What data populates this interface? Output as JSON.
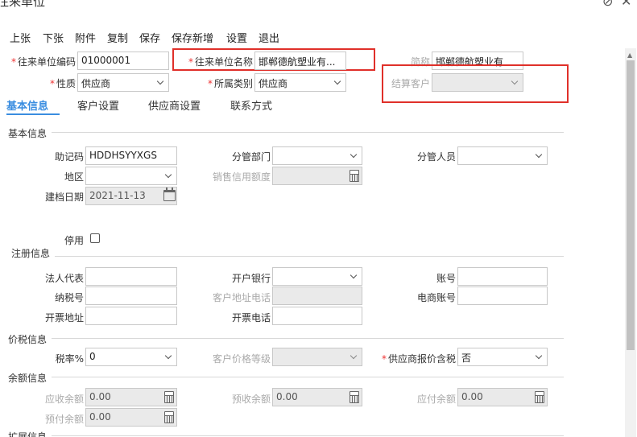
{
  "window": {
    "title": "往来单位"
  },
  "toolbar": {
    "items": [
      "上张",
      "下张",
      "附件",
      "复制",
      "保存",
      "保存新增",
      "设置",
      "退出"
    ]
  },
  "header_fields": {
    "code": {
      "label": "往来单位编码",
      "value": "01000001"
    },
    "name": {
      "label": "往来单位名称",
      "value": "邯郸德航塑业有..."
    },
    "short_name": {
      "label": "简称",
      "value": "邯郸德航塑业有"
    },
    "nature": {
      "label": "性质",
      "value": "供应商"
    },
    "category": {
      "label": "所属类别",
      "value": "供应商"
    },
    "settle_customer": {
      "label": "结算客户",
      "value": ""
    }
  },
  "tabs": [
    "基本信息",
    "客户设置",
    "供应商设置",
    "联系方式"
  ],
  "sections": {
    "basic": "基本信息",
    "register": "注册信息",
    "price_tax": "价税信息",
    "balance": "余额信息",
    "extend": "扩展信息"
  },
  "basic": {
    "mnemonic": {
      "label": "助记码",
      "value": "HDDHSYYXGS"
    },
    "dept": {
      "label": "分管部门",
      "value": ""
    },
    "staff": {
      "label": "分管人员",
      "value": ""
    },
    "region": {
      "label": "地区",
      "value": ""
    },
    "credit": {
      "label": "销售信用额度",
      "value": ""
    },
    "created": {
      "label": "建档日期",
      "value": "2021-11-13"
    },
    "disabled": {
      "label": "停用"
    }
  },
  "register": {
    "legal": {
      "label": "法人代表",
      "value": ""
    },
    "bank": {
      "label": "开户银行",
      "value": ""
    },
    "account": {
      "label": "账号",
      "value": ""
    },
    "taxno": {
      "label": "纳税号",
      "value": ""
    },
    "addr_phone": {
      "label": "客户地址电话",
      "value": ""
    },
    "ecom": {
      "label": "电商账号",
      "value": ""
    },
    "inv_addr": {
      "label": "开票地址",
      "value": ""
    },
    "inv_phone": {
      "label": "开票电话",
      "value": ""
    }
  },
  "price_tax": {
    "rate": {
      "label": "税率%",
      "value": "0"
    },
    "price_level": {
      "label": "客户价格等级",
      "value": ""
    },
    "supplier_tax": {
      "label": "供应商报价含税",
      "value": "否"
    }
  },
  "balance": {
    "receivable": {
      "label": "应收余额",
      "value": "0.00"
    },
    "prepaid_recv": {
      "label": "预收余额",
      "value": "0.00"
    },
    "payable": {
      "label": "应付余额",
      "value": "0.00"
    },
    "prepay": {
      "label": "预付余额",
      "value": "0.00"
    }
  },
  "colors": {
    "accent": "#3a8de0",
    "highlight": "#e0302a",
    "required": "#ee3333"
  }
}
